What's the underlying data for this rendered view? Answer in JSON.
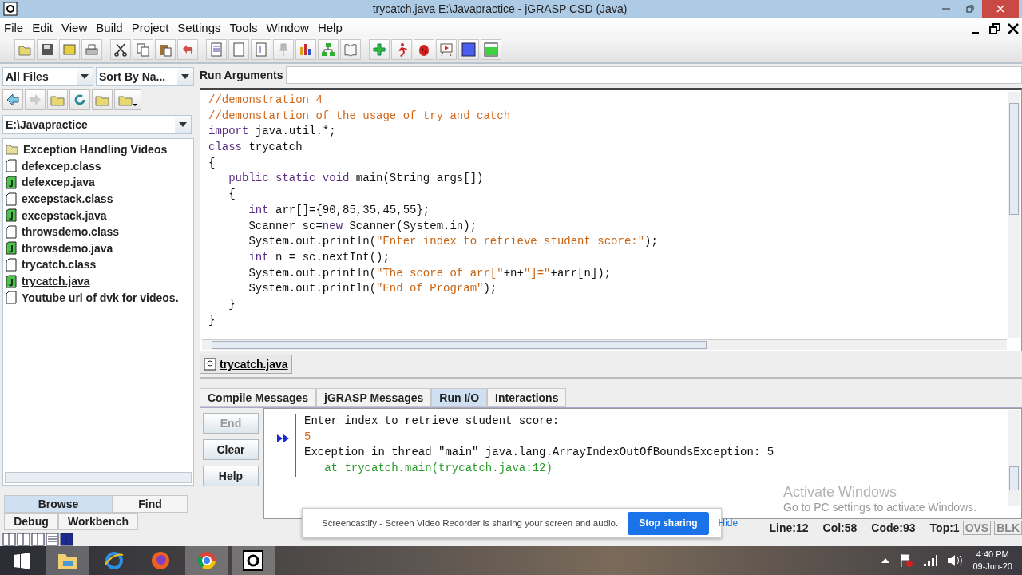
{
  "window": {
    "title": "trycatch.java  E:\\Javapractice - jGRASP CSD (Java)"
  },
  "menu": [
    "File",
    "Edit",
    "View",
    "Build",
    "Project",
    "Settings",
    "Tools",
    "Window",
    "Help"
  ],
  "browse": {
    "filter": "All Files",
    "sort": "Sort By Na...",
    "path": "E:\\Javapractice",
    "files": [
      {
        "name": "Exception Handling Videos",
        "kind": "folder",
        "selected": false
      },
      {
        "name": "defexcep.class",
        "kind": "file",
        "selected": false
      },
      {
        "name": "defexcep.java",
        "kind": "java",
        "selected": false
      },
      {
        "name": "excepstack.class",
        "kind": "file",
        "selected": false
      },
      {
        "name": "excepstack.java",
        "kind": "java",
        "selected": false
      },
      {
        "name": "throwsdemo.class",
        "kind": "file",
        "selected": false
      },
      {
        "name": "throwsdemo.java",
        "kind": "java",
        "selected": false
      },
      {
        "name": "trycatch.class",
        "kind": "file",
        "selected": false
      },
      {
        "name": "trycatch.java",
        "kind": "java",
        "selected": true
      },
      {
        "name": "Youtube url of dvk for videos.",
        "kind": "file",
        "selected": false
      }
    ],
    "tabs": [
      {
        "label": "Browse",
        "selected": true
      },
      {
        "label": "Find",
        "selected": false
      }
    ],
    "tabs2": [
      {
        "label": "Debug",
        "selected": false
      },
      {
        "label": "Workbench",
        "selected": false
      }
    ]
  },
  "run_arguments": {
    "label": "Run Arguments"
  },
  "code": [
    [
      {
        "text": "//demonstration 4",
        "kind": "comment"
      }
    ],
    [
      {
        "text": "//demonstartion of the usage of try and catch",
        "kind": "comment"
      }
    ],
    [
      {
        "text": "import",
        "kind": "keyword"
      },
      {
        "text": " java.util.*;",
        "kind": "plain"
      }
    ],
    [
      {
        "text": "class",
        "kind": "keyword"
      },
      {
        "text": " trycatch",
        "kind": "plain"
      }
    ],
    [
      {
        "text": "{",
        "kind": "plain"
      }
    ],
    [
      {
        "text": "   public static void",
        "kind": "keyword"
      },
      {
        "text": " main(String args[])",
        "kind": "plain"
      }
    ],
    [
      {
        "text": "   {",
        "kind": "plain"
      }
    ],
    [
      {
        "text": "      int",
        "kind": "keyword"
      },
      {
        "text": " arr[]={90,85,35,45,55};",
        "kind": "plain"
      }
    ],
    [
      {
        "text": "      Scanner sc=",
        "kind": "plain"
      },
      {
        "text": "new",
        "kind": "keyword"
      },
      {
        "text": " Scanner(System.in);",
        "kind": "plain"
      }
    ],
    [
      {
        "text": "      System.out.println(",
        "kind": "plain"
      },
      {
        "text": "\"Enter index to retrieve student score:\"",
        "kind": "string"
      },
      {
        "text": ");",
        "kind": "plain"
      }
    ],
    [
      {
        "text": "      int",
        "kind": "keyword"
      },
      {
        "text": " n = sc.nextInt();",
        "kind": "plain"
      }
    ],
    [
      {
        "text": "      System.out.println(",
        "kind": "plain"
      },
      {
        "text": "\"The score of arr[\"",
        "kind": "string"
      },
      {
        "text": "+n+",
        "kind": "plain"
      },
      {
        "text": "\"]=\"",
        "kind": "string"
      },
      {
        "text": "+arr[n]);",
        "kind": "plain"
      }
    ],
    [
      {
        "text": "      System.out.println(",
        "kind": "plain"
      },
      {
        "text": "\"End of Program\"",
        "kind": "string"
      },
      {
        "text": ");",
        "kind": "plain"
      }
    ],
    [
      {
        "text": "   }",
        "kind": "plain"
      }
    ],
    [
      {
        "text": "}",
        "kind": "plain"
      }
    ]
  ],
  "open_file_tab": {
    "label": "trycatch.java",
    "selected": true
  },
  "message_tabs": [
    {
      "label": "Compile Messages",
      "selected": false
    },
    {
      "label": "jGRASP Messages",
      "selected": false
    },
    {
      "label": "Run I/O",
      "selected": true
    },
    {
      "label": "Interactions",
      "selected": false
    }
  ],
  "run_buttons": [
    {
      "label": "End",
      "disabled": true
    },
    {
      "label": "Clear",
      "disabled": false
    },
    {
      "label": "Help",
      "disabled": false
    }
  ],
  "run_output": [
    {
      "text": "Enter index to retrieve student score:",
      "kind": "output"
    },
    {
      "text": "5",
      "kind": "input"
    },
    {
      "text": "Exception in thread \"main\" java.lang.ArrayIndexOutOfBoundsException: 5",
      "kind": "output"
    },
    {
      "text": "   at trycatch.main(trycatch.java:12)",
      "kind": "stack"
    }
  ],
  "activation_notice": {
    "title": "Activate Windows",
    "subtitle": "Go to PC settings to activate Windows."
  },
  "sharing_bar": {
    "message": "Screencastify - Screen Video Recorder is sharing your screen and audio.",
    "stop": "Stop sharing",
    "hide": "Hide"
  },
  "status_bar": {
    "line": "Line:12",
    "col": "Col:58",
    "code": "Code:93",
    "top": "Top:1",
    "ovs": "OVS",
    "blk": "BLK"
  },
  "taskbar": {
    "time": "4:40 PM",
    "date": "09-Jun-20"
  }
}
